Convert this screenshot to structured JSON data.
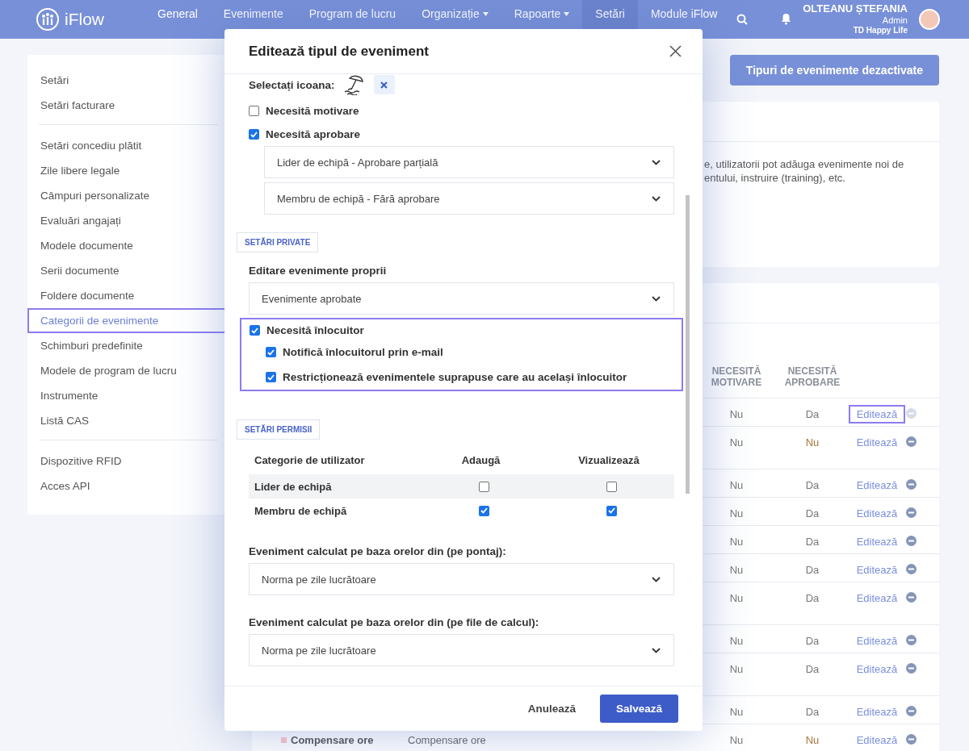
{
  "header": {
    "logo": "iFlow",
    "nav": [
      {
        "label": "General",
        "selected": false,
        "dropdown": false
      },
      {
        "label": "Evenimente",
        "selected": false,
        "dropdown": false
      },
      {
        "label": "Program de lucru",
        "selected": false,
        "dropdown": false
      },
      {
        "label": "Organizație",
        "selected": false,
        "dropdown": true
      },
      {
        "label": "Rapoarte",
        "selected": false,
        "dropdown": true
      },
      {
        "label": "Setări",
        "selected": true,
        "dropdown": false
      },
      {
        "label": "Module iFlow",
        "selected": false,
        "dropdown": false
      }
    ],
    "user": {
      "name": "OLTEANU ȘTEFANIA",
      "role": "Admin",
      "company": "TD Happy Life"
    }
  },
  "sidebar": {
    "sections": [
      {
        "items": [
          {
            "label": "Setări",
            "selected": false
          },
          {
            "label": "Setări facturare",
            "selected": false
          }
        ]
      },
      {
        "items": [
          {
            "label": "Setări concediu plătit",
            "selected": false
          },
          {
            "label": "Zile libere legale",
            "selected": false
          },
          {
            "label": "Câmpuri personalizate",
            "selected": false
          },
          {
            "label": "Evaluări angajați",
            "selected": false
          },
          {
            "label": "Modele documente",
            "selected": false
          },
          {
            "label": "Serii documente",
            "selected": false
          },
          {
            "label": "Foldere documente",
            "selected": false
          },
          {
            "label": "Categorii de evenimente",
            "selected": true
          },
          {
            "label": "Schimburi predefinite",
            "selected": false
          },
          {
            "label": "Modele de program de lucru",
            "selected": false
          },
          {
            "label": "Instrumente",
            "selected": false
          },
          {
            "label": "Listă CAS",
            "selected": false
          }
        ]
      },
      {
        "items": [
          {
            "label": "Dispozitive RFID",
            "selected": false
          },
          {
            "label": "Acces API",
            "selected": false
          }
        ]
      }
    ]
  },
  "main": {
    "top_button": "Tipuri de evenimente dezactivate",
    "intro_lines": [
      "e, utilizatorii pot adăuga evenimente noi de",
      "entului, instruire (training), etc."
    ],
    "table": {
      "columns": [
        "NECESITĂ MOTIVARE",
        "NECESITĂ APROBARE"
      ],
      "rows": [
        {
          "motivare": "Nu",
          "aprobare": "Da",
          "aprobare_warning": false,
          "action": "Editează",
          "highlighted": true,
          "disabled": true,
          "wrapped": false
        },
        {
          "motivare": "Nu",
          "aprobare": "Nu",
          "aprobare_warning": true,
          "action": "Editează",
          "highlighted": false,
          "disabled": false,
          "wrapped": true
        },
        {
          "motivare": "Nu",
          "aprobare": "Da",
          "aprobare_warning": false,
          "action": "Editează",
          "highlighted": false,
          "disabled": false,
          "wrapped": false
        },
        {
          "motivare": "Nu",
          "aprobare": "Da",
          "aprobare_warning": false,
          "action": "Editează",
          "highlighted": false,
          "disabled": false,
          "wrapped": false
        },
        {
          "motivare": "Nu",
          "aprobare": "Da",
          "aprobare_warning": false,
          "action": "Editează",
          "highlighted": false,
          "disabled": false,
          "wrapped": false
        },
        {
          "motivare": "Nu",
          "aprobare": "Da",
          "aprobare_warning": false,
          "action": "Editează",
          "highlighted": false,
          "disabled": false,
          "wrapped": false
        },
        {
          "motivare": "Nu",
          "aprobare": "Da",
          "aprobare_warning": false,
          "action": "Editează",
          "highlighted": false,
          "disabled": false,
          "wrapped": true
        },
        {
          "motivare": "Nu",
          "aprobare": "Da",
          "aprobare_warning": false,
          "action": "Editează",
          "highlighted": false,
          "disabled": false,
          "wrapped": false
        },
        {
          "motivare": "Nu",
          "aprobare": "Da",
          "aprobare_warning": false,
          "action": "Editează",
          "highlighted": false,
          "disabled": false,
          "wrapped": true
        },
        {
          "motivare": "Nu",
          "aprobare": "Da",
          "aprobare_warning": false,
          "action": "Editează",
          "highlighted": false,
          "disabled": false,
          "wrapped": false
        },
        {
          "name": "Compensare ore",
          "description": "Compensare ore",
          "color": "#e8b7c6",
          "motivare": "Nu",
          "aprobare": "Nu",
          "aprobare_warning": true,
          "action": "Editează",
          "highlighted": false,
          "disabled": false,
          "wrapped": false
        }
      ]
    }
  },
  "modal": {
    "title": "Editează tipul de eveniment",
    "icon_label": "Selectați icoana:",
    "requires_reason": {
      "label": "Necesită motivare",
      "checked": false
    },
    "requires_approval": {
      "label": "Necesită aprobare",
      "checked": true
    },
    "approval_selects": [
      "Lider de echipă - Aprobare parțială",
      "Membru de echipă - Fără aprobare"
    ],
    "private_section": "SETĂRI PRIVATE",
    "edit_own_label": "Editare evenimente proprii",
    "edit_own_value": "Evenimente aprobate",
    "replacement": {
      "highlighted": true,
      "label": "Necesită înlocuitor",
      "checked": true,
      "options": [
        {
          "label": "Notifică înlocuitorul prin e-mail",
          "checked": true
        },
        {
          "label": "Restricționează evenimentele suprapuse care au același înlocuitor",
          "checked": true
        }
      ]
    },
    "permissions_section": "SETĂRI PERMISII",
    "permissions": {
      "columns": [
        "Categorie de utilizator",
        "Adaugă",
        "Vizualizează"
      ],
      "rows": [
        {
          "name": "Lider de echipă",
          "add": false,
          "view": false
        },
        {
          "name": "Membru de echipă",
          "add": true,
          "view": true
        }
      ]
    },
    "calc_fields": [
      {
        "label": "Eveniment calculat pe baza orelor din (pe pontaj):",
        "value": "Norma pe zile lucrătoare"
      },
      {
        "label": "Eveniment calculat pe baza orelor din (pe file de calcul):",
        "value": "Norma pe zile lucrătoare"
      }
    ],
    "cancel": "Anulează",
    "save": "Salvează"
  }
}
